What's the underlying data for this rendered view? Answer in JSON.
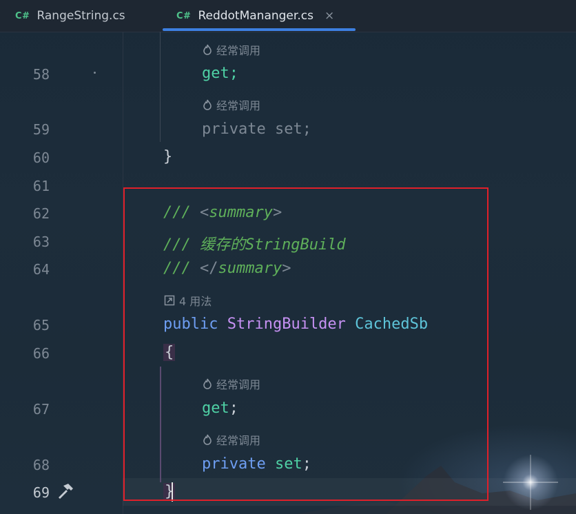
{
  "tabs": [
    {
      "badge": "C#",
      "label": "RangeString.cs",
      "active": false
    },
    {
      "badge": "C#",
      "label": "ReddotMananger.cs",
      "active": true,
      "close": "×"
    }
  ],
  "hints": {
    "frequent": "经常调用",
    "usages": "4 用法"
  },
  "lines": {
    "l58": {
      "num": "58",
      "code": "get;"
    },
    "l59": {
      "num": "59",
      "code_kw": "private",
      "code_rest": " set;"
    },
    "l60": {
      "num": "60",
      "code": "}"
    },
    "l61": {
      "num": "61"
    },
    "l62": {
      "num": "62",
      "slashes": "/// ",
      "open": "<",
      "tag": "summary",
      "close": ">"
    },
    "l63": {
      "num": "63",
      "slashes": "/// ",
      "text": "缓存的StringBuild"
    },
    "l64": {
      "num": "64",
      "slashes": "/// ",
      "open": "</",
      "tag": "summary",
      "close": ">"
    },
    "l65": {
      "num": "65",
      "kw": "public",
      "type": "StringBuilder",
      "prop": "CachedSb"
    },
    "l66": {
      "num": "66",
      "code": "{"
    },
    "l67": {
      "num": "67",
      "acc": "get",
      "semi": ";"
    },
    "l68": {
      "num": "68",
      "kw": "private",
      "acc": "set",
      "semi": ";"
    },
    "l69": {
      "num": "69",
      "code": "}"
    }
  },
  "icons": {
    "hammer": "hammer-icon",
    "flame": "flame-icon",
    "usages": "external-link-icon"
  },
  "colors": {
    "keyword": "#6e9ef2",
    "type": "#c691f3",
    "property": "#5ec4d9",
    "accessor": "#4fd1a5",
    "comment": "#5fb05a",
    "highlight_box": "#e0202a",
    "tab_underline": "#3d7fe0"
  }
}
